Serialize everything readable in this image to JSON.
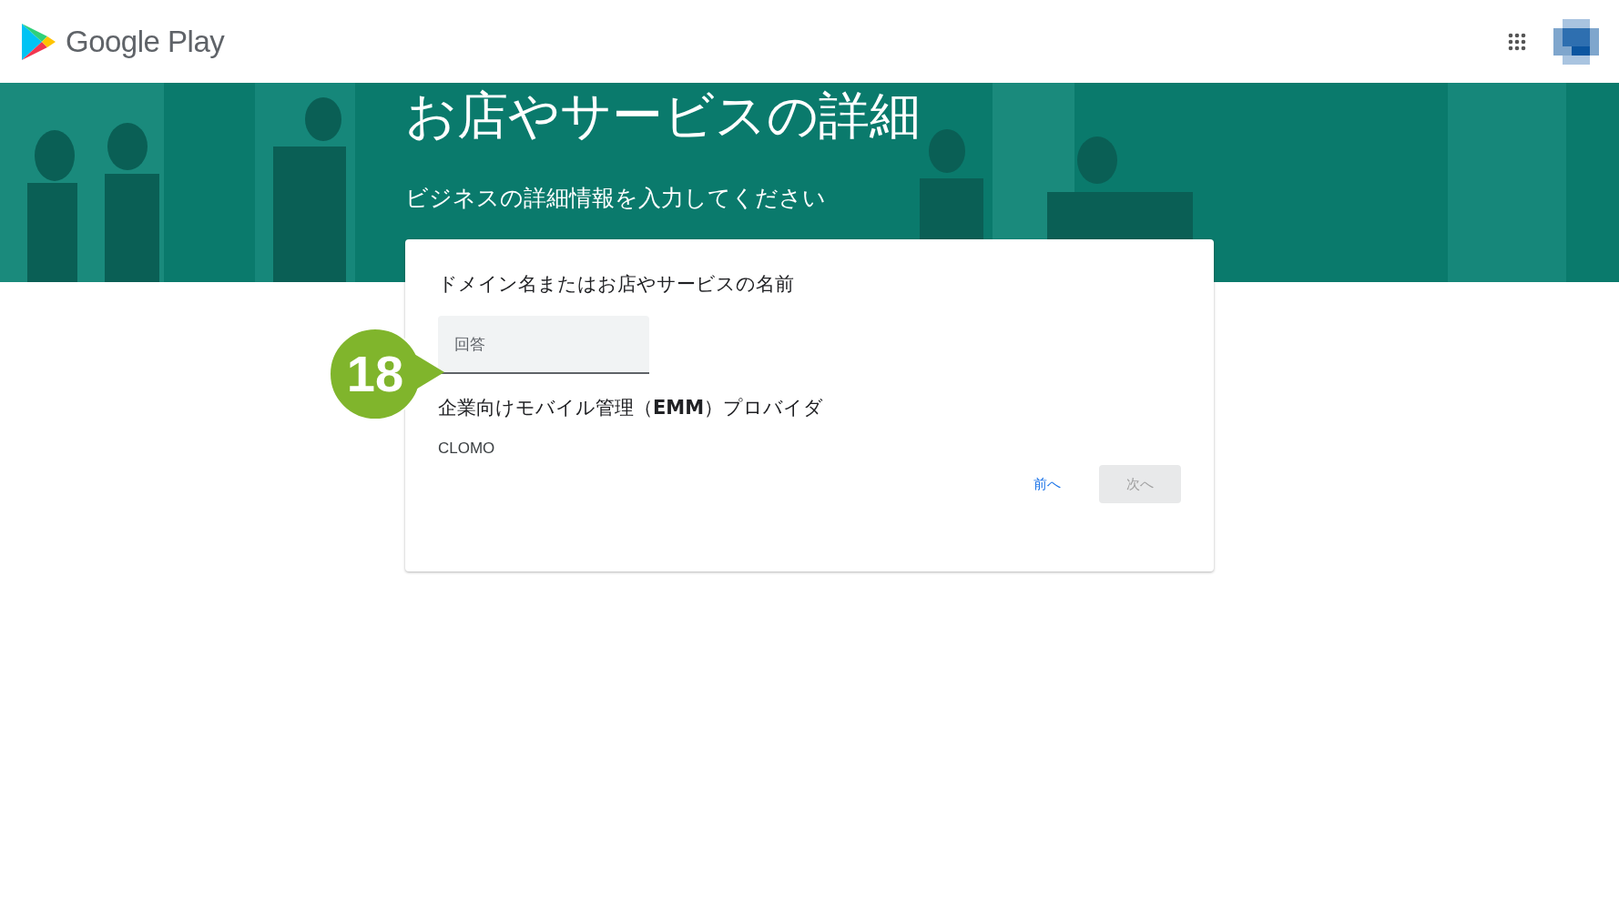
{
  "header": {
    "logo_text": "Google Play"
  },
  "banner": {
    "title": "お店やサービスの詳細",
    "subtitle": "ビジネスの詳細情報を入力してください"
  },
  "step_badge": "18",
  "form": {
    "fields": [
      {
        "kind": "input",
        "label": "ドメイン名またはお店やサービスの名前",
        "placeholder": "回答"
      },
      {
        "kind": "static",
        "label": "企業向けモバイル管理（**EMM**）プロバイダ",
        "value": "CLOMO"
      }
    ],
    "buttons": [
      {
        "kind": "text",
        "label": "前へ",
        "disabled": false
      },
      {
        "kind": "filled",
        "label": "次へ",
        "disabled": true
      }
    ]
  }
}
